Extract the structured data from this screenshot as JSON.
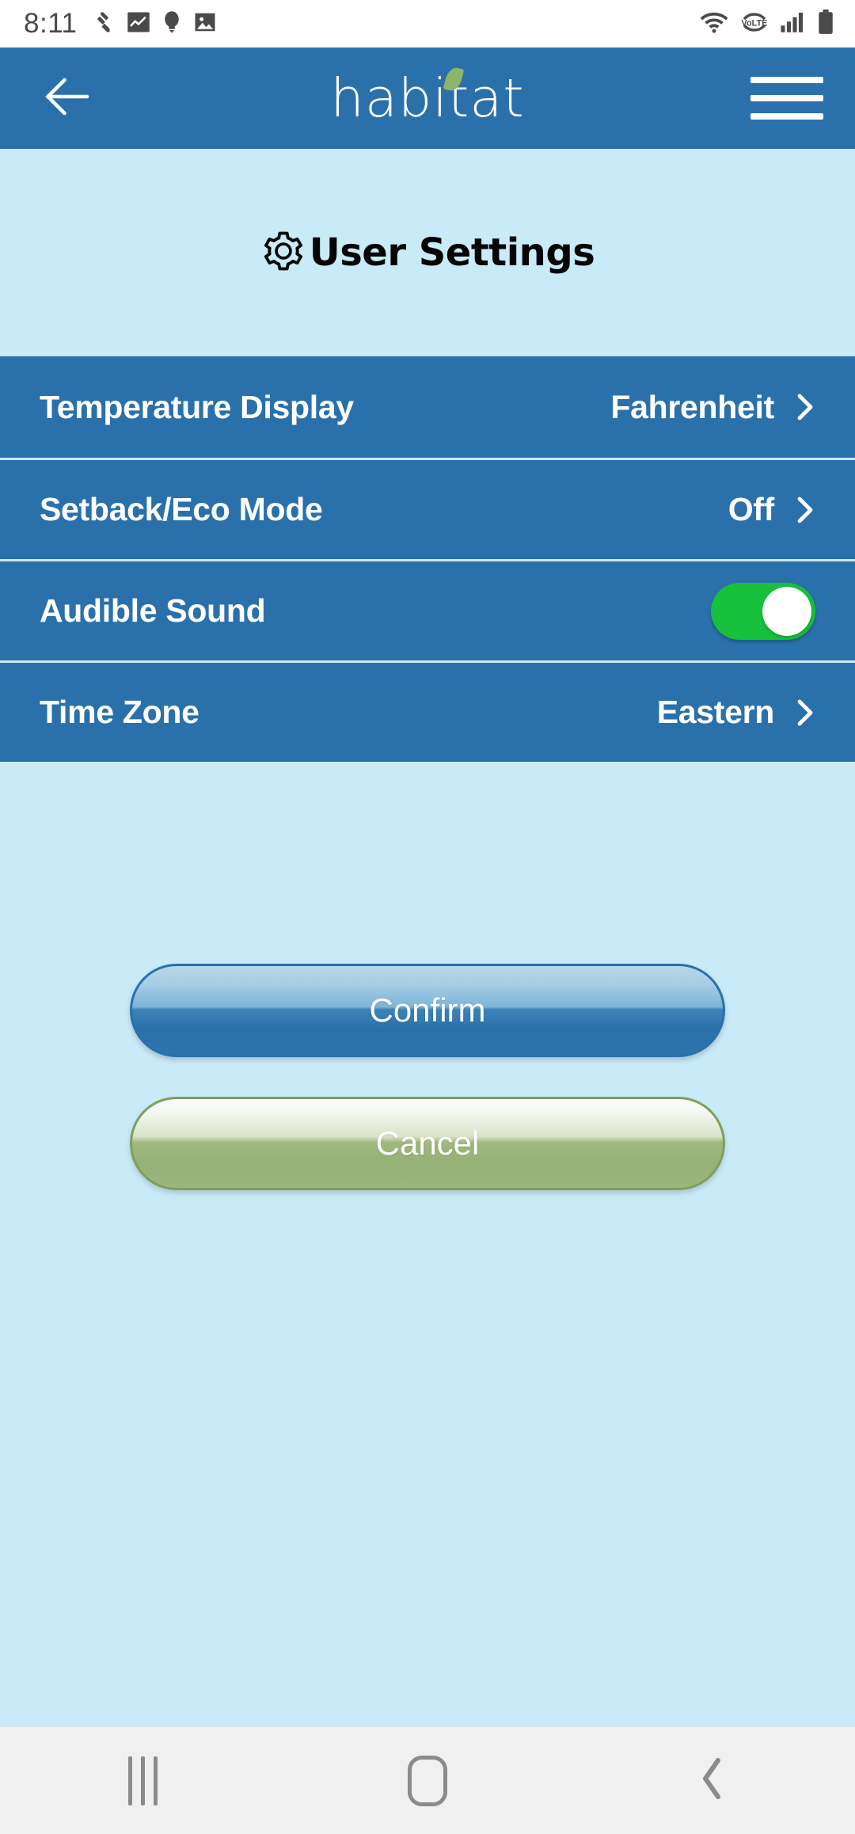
{
  "status_bar": {
    "time": "8:11",
    "left_icons": [
      "jira-icon",
      "chart-app-icon",
      "lightbulb-icon",
      "image-icon"
    ],
    "right_icons": [
      "wifi-icon",
      "volte-icon",
      "cellular-signal-icon",
      "battery-icon"
    ],
    "volte_label": "VoLTE"
  },
  "header": {
    "back_icon": "back-arrow-icon",
    "brand": "habitat",
    "leaf_icon": "leaf-icon",
    "menu_icon": "hamburger-menu-icon"
  },
  "page": {
    "gear_icon": "gear-icon",
    "title": "User Settings"
  },
  "settings": {
    "rows": [
      {
        "label": "Temperature Display",
        "value": "Fahrenheit",
        "control": "chevron",
        "icon": "chevron-right-icon"
      },
      {
        "label": "Setback/Eco Mode",
        "value": "Off",
        "control": "chevron",
        "icon": "chevron-right-icon"
      },
      {
        "label": "Audible Sound",
        "value": "",
        "control": "toggle",
        "toggle_on": true
      },
      {
        "label": "Time Zone",
        "value": "Eastern",
        "control": "chevron",
        "icon": "chevron-right-icon"
      }
    ]
  },
  "actions": {
    "confirm_label": "Confirm",
    "cancel_label": "Cancel"
  },
  "nav_bar": {
    "recents_icon": "recents-icon",
    "home_icon": "home-icon",
    "back_icon": "nav-back-icon"
  },
  "colors": {
    "brand_blue": "#2a71ab",
    "page_background": "#c9ebf7",
    "divider": "#cfe9f2",
    "toggle_on": "#17c13c",
    "leaf_green": "#8cb46a",
    "cancel_green": "#96b176",
    "status_icon_gray": "#4a4a4a",
    "nav_icon_gray": "#8b8b8b"
  }
}
